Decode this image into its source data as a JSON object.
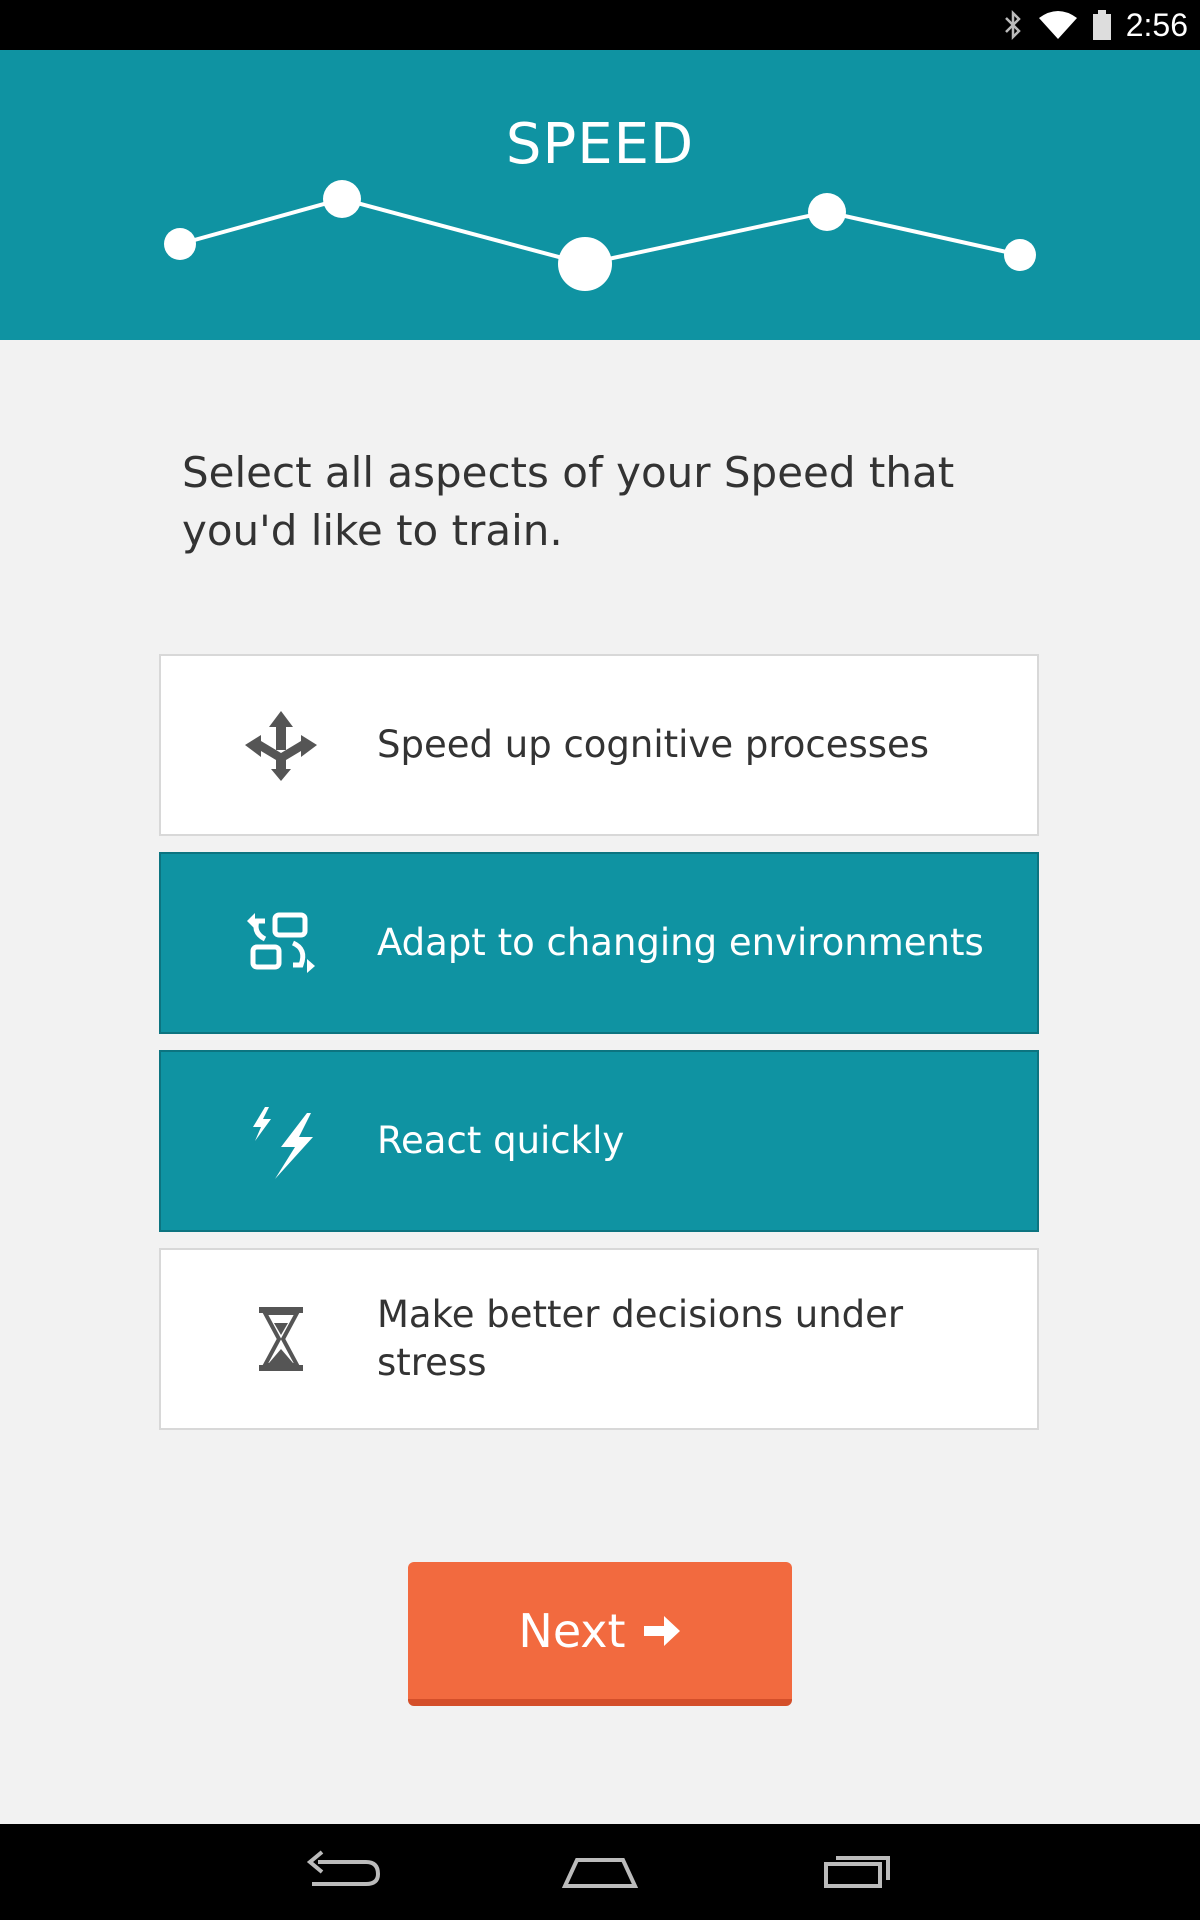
{
  "status_bar": {
    "time": "2:56",
    "icons": [
      "bluetooth-icon",
      "wifi-icon",
      "battery-icon"
    ]
  },
  "header": {
    "title": "SPEED",
    "progress_steps": 5,
    "current_step": 3
  },
  "prompt": "Select all aspects of your Speed that you'd like to train.",
  "options": [
    {
      "label": "Speed up cognitive processes",
      "icon": "arrows-diverge-icon",
      "selected": false
    },
    {
      "label": "Adapt to changing environments",
      "icon": "swap-icon",
      "selected": true
    },
    {
      "label": "React quickly",
      "icon": "lightning-icon",
      "selected": true
    },
    {
      "label": "Make better decisions under stress",
      "icon": "hourglass-icon",
      "selected": false
    }
  ],
  "next_button": {
    "label": "Next",
    "icon": "arrow-right-icon"
  },
  "nav_bar": {
    "icons": [
      "back-icon",
      "home-icon",
      "recents-icon"
    ]
  },
  "colors": {
    "accent": "#0f93a2",
    "button": "#f26a3f",
    "background": "#f2f2f2"
  }
}
